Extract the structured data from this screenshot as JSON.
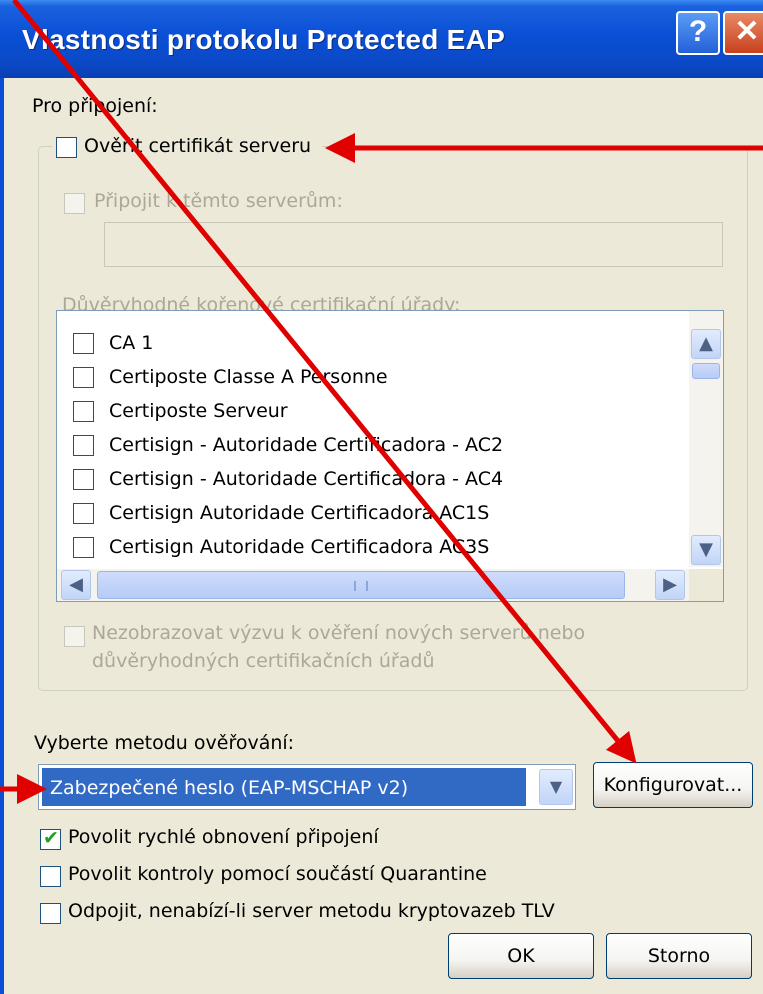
{
  "window": {
    "title": "Vlastnosti protokolu Protected EAP",
    "help_glyph": "?",
    "close_glyph": "✕"
  },
  "connection": {
    "label": "Pro připojení:",
    "validate_cert": {
      "label": "Ověřit certifikát serveru",
      "checked": false
    },
    "connect_servers": {
      "label": "Připojit k těmto serverům:",
      "checked": false,
      "disabled": true,
      "value": ""
    },
    "trusted_ca_label": "Důvěryhodné kořenové certifikační úřady:",
    "ca_list": [
      {
        "label": "CA 1",
        "checked": false
      },
      {
        "label": "Certiposte Classe A Personne",
        "checked": false
      },
      {
        "label": "Certiposte Serveur",
        "checked": false
      },
      {
        "label": "Certisign - Autoridade Certificadora - AC2",
        "checked": false
      },
      {
        "label": "Certisign - Autoridade Certificadora - AC4",
        "checked": false
      },
      {
        "label": "Certisign Autoridade Certificadora AC1S",
        "checked": false
      },
      {
        "label": "Certisign Autoridade Certificadora AC3S",
        "checked": false
      }
    ],
    "no_prompt": {
      "line1": "Nezobrazovat výzvu k ověření nových serverů nebo",
      "line2": "důvěryhodných certifikačních úřadů",
      "checked": false,
      "disabled": true
    }
  },
  "auth": {
    "label": "Vyberte metodu ověřování:",
    "method": "Zabezpečené heslo (EAP-MSCHAP v2)",
    "configure_label": "Konfigurovat..."
  },
  "options": [
    {
      "label": "Povolit rychlé obnovení připojení",
      "checked": true
    },
    {
      "label": "Povolit kontroly pomocí součástí Quarantine",
      "checked": false
    },
    {
      "label": "Odpojit, nenabízí-li server metodu kryptovazeb TLV",
      "checked": false
    }
  ],
  "buttons": {
    "ok": "OK",
    "cancel": "Storno"
  },
  "colors": {
    "accent": "#0a4fd6",
    "dialog_bg": "#ece9d8",
    "selection": "#316ac5",
    "annotation_arrow": "#e00000"
  }
}
